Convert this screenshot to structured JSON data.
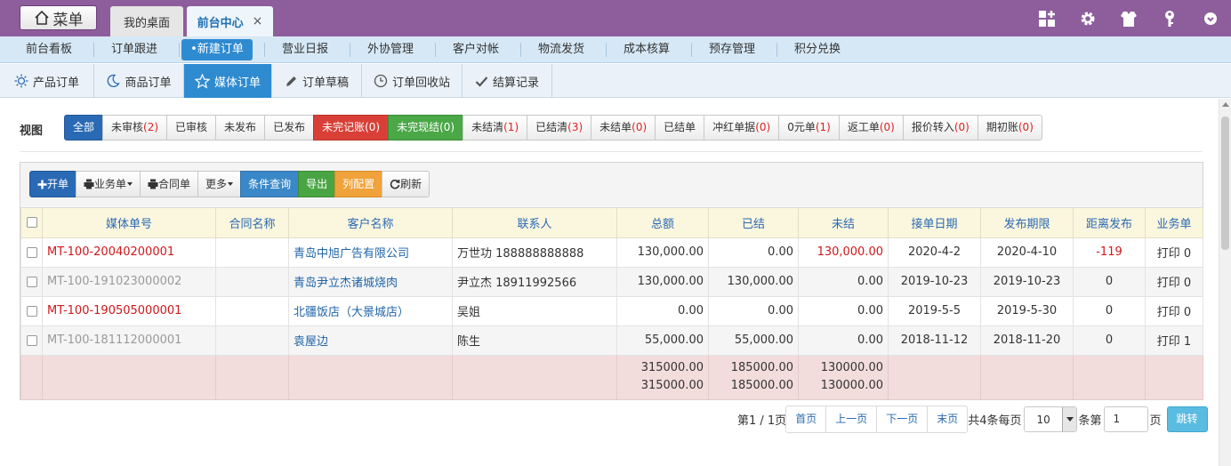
{
  "topbar": {
    "menu_label": "菜单",
    "tabs": [
      {
        "label": "我的桌面"
      },
      {
        "label": "前台中心",
        "close": "×"
      }
    ],
    "icons": [
      "grid-add-icon",
      "gear-icon",
      "shirt-icon",
      "key-icon",
      "chevron-icon"
    ]
  },
  "nav1": [
    "前台看板",
    "订单跟进",
    "•新建订单",
    "营业日报",
    "外协管理",
    "客户对帐",
    "物流发货",
    "成本核算",
    "预存管理",
    "积分兑换"
  ],
  "nav2": [
    "产品订单",
    "商品订单",
    "媒体订单",
    "订单草稿",
    "订单回收站",
    "结算记录"
  ],
  "view": {
    "label": "视图",
    "filters": [
      {
        "label": "全部",
        "count": ""
      },
      {
        "label": "未审核",
        "count": "(2)"
      },
      {
        "label": "已审核",
        "count": ""
      },
      {
        "label": "未发布",
        "count": ""
      },
      {
        "label": "已发布",
        "count": ""
      },
      {
        "label": "未完记账",
        "count": "(0)"
      },
      {
        "label": "未完现结",
        "count": "(0)"
      },
      {
        "label": "未结清",
        "count": "(1)"
      },
      {
        "label": "已结清",
        "count": "(3)"
      },
      {
        "label": "未结单",
        "count": "(0)"
      },
      {
        "label": "已结单",
        "count": ""
      },
      {
        "label": "冲红单据",
        "count": "(0)"
      },
      {
        "label": "0元单",
        "count": "(1)"
      },
      {
        "label": "返工单",
        "count": "(0)"
      },
      {
        "label": "报价转入",
        "count": "(0)"
      },
      {
        "label": "期初账",
        "count": "(0)"
      }
    ]
  },
  "toolbar": {
    "open": "开单",
    "business": "业务单",
    "contract": "合同单",
    "more": "更多",
    "query": "条件查询",
    "export": "导出",
    "columns": "列配置",
    "refresh": "刷新"
  },
  "table": {
    "headers": [
      "媒体单号",
      "合同名称",
      "客户名称",
      "联系人",
      "总额",
      "已结",
      "未结",
      "接单日期",
      "发布期限",
      "距离发布",
      "业务单"
    ],
    "rows": [
      {
        "no": "MT-100-20040200001",
        "contract": "",
        "customer": "青岛中旭广告有限公司",
        "contact": "万世功 188888888888",
        "total": "130,000.00",
        "paid": "0.00",
        "unpaid": "130,000.00",
        "date": "2020-4-2",
        "deadline": "2020-4-10",
        "distance": "-119",
        "print": "打印 0"
      },
      {
        "no": "MT-100-191023000002",
        "contract": "",
        "customer": "青岛尹立杰诸城烧肉",
        "contact": "尹立杰 18911992566",
        "total": "130,000.00",
        "paid": "130,000.00",
        "unpaid": "0.00",
        "date": "2019-10-23",
        "deadline": "2019-10-23",
        "distance": "0",
        "print": "打印 0"
      },
      {
        "no": "MT-100-190505000001",
        "contract": "",
        "customer": "北疆饭店（大景城店）",
        "contact": "吴姐",
        "total": "0.00",
        "paid": "0.00",
        "unpaid": "0.00",
        "date": "2019-5-5",
        "deadline": "2019-5-30",
        "distance": "0",
        "print": "打印 0"
      },
      {
        "no": "MT-100-181112000001",
        "contract": "",
        "customer": "袁屋边",
        "contact": "陈生",
        "total": "55,000.00",
        "paid": "55,000.00",
        "unpaid": "0.00",
        "date": "2018-11-12",
        "deadline": "2018-11-20",
        "distance": "0",
        "print": "打印 1"
      }
    ],
    "summary": {
      "total": [
        "315000.00",
        "315000.00"
      ],
      "paid": [
        "185000.00",
        "185000.00"
      ],
      "unpaid": [
        "130000.00",
        "130000.00"
      ]
    }
  },
  "pager": {
    "page_info": "第1 / 1页",
    "first": "首页",
    "prev": "上一页",
    "next": "下一页",
    "last": "末页",
    "count_text": "共4条每页",
    "page_size": "10",
    "goto_prefix": "条第",
    "page_input": "1",
    "page_suffix": "页",
    "go": "跳转"
  },
  "colors": {
    "brand_purple": "#8e5d9b",
    "accent_blue": "#2f8bd0",
    "red": "#d0171a"
  }
}
